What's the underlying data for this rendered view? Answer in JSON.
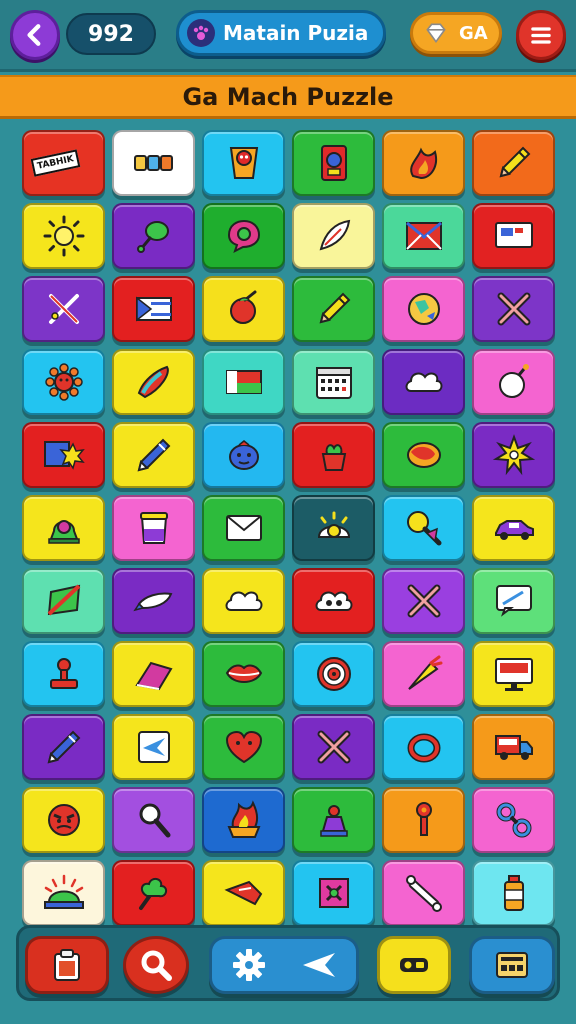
{
  "header": {
    "score": "992",
    "title": "Matain Puzia",
    "coins": "GA"
  },
  "banner": {
    "title": "Ga Mach Puzzle"
  },
  "tiles": [
    {
      "color": "#e63323",
      "icon": "ticket-label-icon",
      "label": "TABHIK"
    },
    {
      "color": "#ffffff",
      "icon": "battery-cells-icon"
    },
    {
      "color": "#23c4f0",
      "icon": "skull-poster-icon"
    },
    {
      "color": "#2dbb3c",
      "icon": "robot-card-icon"
    },
    {
      "color": "#f59a1a",
      "icon": "flame-icon"
    },
    {
      "color": "#f26a1b",
      "icon": "pencil-icon"
    },
    {
      "color": "#f5e51c",
      "icon": "sun-icon"
    },
    {
      "color": "#7a2bc4",
      "icon": "leaf-balloon-icon"
    },
    {
      "color": "#1fae2e",
      "icon": "chat-bubble-icon"
    },
    {
      "color": "#f9f59a",
      "icon": "feather-icon"
    },
    {
      "color": "#4bd89a",
      "icon": "envelope-flag-icon"
    },
    {
      "color": "#e22222",
      "icon": "screen-icon"
    },
    {
      "color": "#7d35c8",
      "icon": "crossed-tools-icon"
    },
    {
      "color": "#e32020",
      "icon": "flag-icon"
    },
    {
      "color": "#f5e01c",
      "icon": "tomato-icon"
    },
    {
      "color": "#2dbb3c",
      "icon": "pencil-icon"
    },
    {
      "color": "#f464d0",
      "icon": "globe-icon"
    },
    {
      "color": "#7d35c8",
      "icon": "cross-icon"
    },
    {
      "color": "#23c4f0",
      "icon": "sunflower-icon"
    },
    {
      "color": "#f5e51c",
      "icon": "banana-icon"
    },
    {
      "color": "#3fd7c4",
      "icon": "flag-blocks-icon"
    },
    {
      "color": "#5ee0b0",
      "icon": "calendar-icon"
    },
    {
      "color": "#6c2cc2",
      "icon": "cloud-icon"
    },
    {
      "color": "#f464d0",
      "icon": "bomb-icon"
    },
    {
      "color": "#e32020",
      "icon": "map-burst-icon"
    },
    {
      "color": "#f5e51c",
      "icon": "pen-icon"
    },
    {
      "color": "#23b8f0",
      "icon": "blob-face-icon"
    },
    {
      "color": "#e32020",
      "icon": "plant-pot-icon"
    },
    {
      "color": "#2dbb3c",
      "icon": "paint-blob-icon"
    },
    {
      "color": "#7a2bc4",
      "icon": "starburst-icon"
    },
    {
      "color": "#f5e51c",
      "icon": "alarm-bell-icon"
    },
    {
      "color": "#f464d0",
      "icon": "jar-icon"
    },
    {
      "color": "#2dbb3c",
      "icon": "envelope-icon"
    },
    {
      "color": "#1c5c66",
      "icon": "sunrise-icon"
    },
    {
      "color": "#23c4f0",
      "icon": "magnifier-ribbon-icon"
    },
    {
      "color": "#f5e51c",
      "icon": "car-icon"
    },
    {
      "color": "#5ee0b0",
      "icon": "folder-split-icon"
    },
    {
      "color": "#7a2bc4",
      "icon": "rocket-icon"
    },
    {
      "color": "#f5e51c",
      "icon": "cloud-icon"
    },
    {
      "color": "#e32020",
      "icon": "cloud-eyes-icon"
    },
    {
      "color": "#9a3fe0",
      "icon": "cross-icon"
    },
    {
      "color": "#5ee07a",
      "icon": "chat-screen-icon"
    },
    {
      "color": "#23c4f0",
      "icon": "stamp-icon"
    },
    {
      "color": "#f5e51c",
      "icon": "eraser-icon"
    },
    {
      "color": "#2dbb3c",
      "icon": "lips-icon"
    },
    {
      "color": "#23c4f0",
      "icon": "target-icon"
    },
    {
      "color": "#f464d0",
      "icon": "carrot-icon"
    },
    {
      "color": "#f5e51c",
      "icon": "monitor-icon"
    },
    {
      "color": "#7a2bc4",
      "icon": "pen-icon"
    },
    {
      "color": "#f5e51c",
      "icon": "plane-card-icon"
    },
    {
      "color": "#2dbb3c",
      "icon": "heart-face-icon"
    },
    {
      "color": "#7a2bc4",
      "icon": "cross-icon"
    },
    {
      "color": "#23c4f0",
      "icon": "ring-icon"
    },
    {
      "color": "#f59a1a",
      "icon": "truck-icon"
    },
    {
      "color": "#f5e51c",
      "icon": "angry-face-icon"
    },
    {
      "color": "#a34fe0",
      "icon": "magnifier-icon"
    },
    {
      "color": "#1e6ad0",
      "icon": "fire-pot-icon"
    },
    {
      "color": "#2dbb3c",
      "icon": "potion-icon"
    },
    {
      "color": "#f59a1a",
      "icon": "key-icon"
    },
    {
      "color": "#f464d0",
      "icon": "chain-link-icon"
    },
    {
      "color": "#fdf6dc",
      "icon": "dome-lamp-icon"
    },
    {
      "color": "#e32020",
      "icon": "plant-sprout-icon"
    },
    {
      "color": "#f5e51c",
      "icon": "shoe-icon"
    },
    {
      "color": "#23c4f0",
      "icon": "chip-icon"
    },
    {
      "color": "#f464d0",
      "icon": "bone-icon"
    },
    {
      "color": "#6ee6f0",
      "icon": "bottle-icon"
    }
  ],
  "bottom_bar": {
    "buttons": [
      {
        "name": "clipboard-button",
        "color": "#d9301f"
      },
      {
        "name": "search-button",
        "color": "#d9301f"
      },
      {
        "name": "settings-button",
        "color": "#2a8fd0"
      },
      {
        "name": "key-button",
        "color": "#f5e01c"
      },
      {
        "name": "cards-button",
        "color": "#2a8fd0"
      }
    ]
  }
}
